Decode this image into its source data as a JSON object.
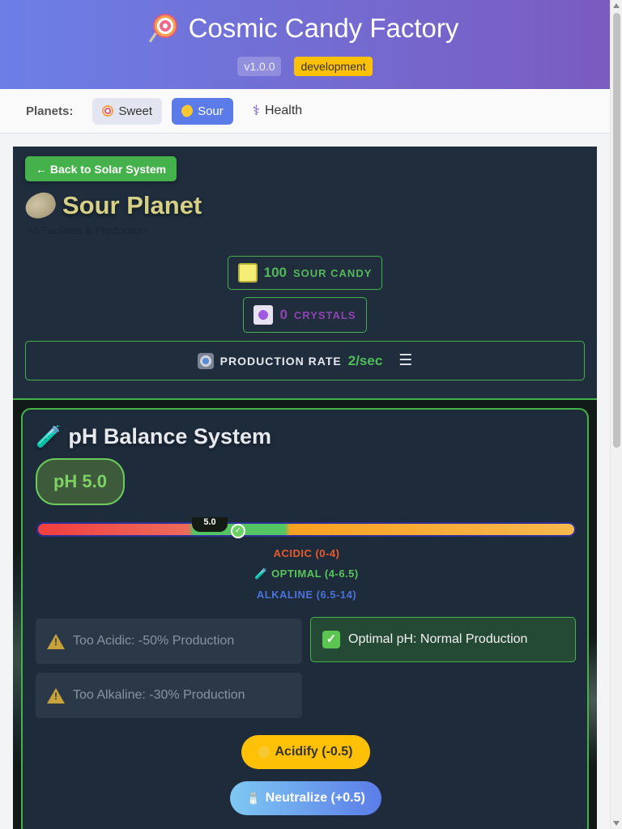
{
  "header": {
    "title": "Cosmic Candy Factory",
    "version": "v1.0.0",
    "environment": "development",
    "icon": "lollipop-icon"
  },
  "planets_nav": {
    "label": "Planets:",
    "items": [
      {
        "label": "Sweet",
        "icon": "lollipop-icon",
        "active": false
      },
      {
        "label": "Sour",
        "icon": "lemon-icon",
        "active": true
      },
      {
        "label": "Health",
        "icon": "caduceus-icon",
        "active": false
      }
    ]
  },
  "planet": {
    "back_label": "← Back to Solar System",
    "title": "Sour Planet",
    "subtitle": "All Facilities & Production"
  },
  "stats": {
    "candy": {
      "value": "100",
      "label": "SOUR CANDY"
    },
    "crystals": {
      "value": "0",
      "label": "CRYSTALS"
    },
    "production": {
      "label": "PRODUCTION RATE",
      "value": "2/sec"
    }
  },
  "ph_system": {
    "title": "pH Balance System",
    "current": "pH 5.0",
    "marker": "5.0",
    "value": 5.0,
    "zones": {
      "acidic": "ACIDIC (0-4)",
      "optimal": "OPTIMAL (4-6.5)",
      "alkaline": "ALKALINE (6.5-14)"
    },
    "effects": {
      "acidic": "Too Acidic: -50% Production",
      "optimal": "Optimal pH: Normal Production",
      "alkaline": "Too Alkaline: -30% Production"
    },
    "actions": {
      "acidify": "Acidify (-0.5)",
      "neutralize": "Neutralize (+0.5)"
    }
  },
  "colors": {
    "header_start": "#6c7fe6",
    "header_end": "#7a5bc0",
    "accent_green": "#44b14a",
    "active_tab": "#5b7ce8",
    "env_badge": "#ffc107"
  }
}
